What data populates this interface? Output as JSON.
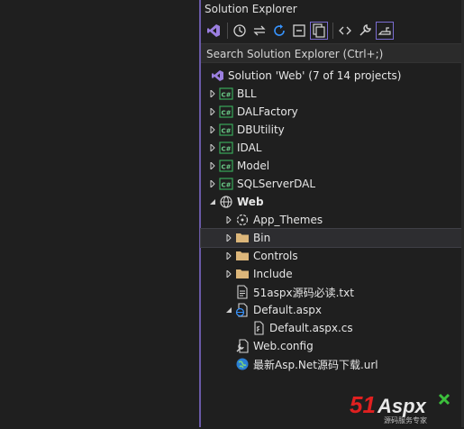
{
  "panel": {
    "title": "Solution Explorer",
    "search_placeholder": "Search Solution Explorer (Ctrl+;)"
  },
  "toolbar": [
    {
      "name": "vs-icon"
    },
    {
      "name": "history-icon"
    },
    {
      "name": "sync-icon"
    },
    {
      "name": "refresh-icon"
    },
    {
      "name": "collapse-all-icon"
    },
    {
      "name": "show-all-files-icon",
      "active": true
    },
    {
      "name": "code-icon"
    },
    {
      "name": "properties-icon"
    },
    {
      "name": "preview-icon",
      "active": true
    }
  ],
  "tree": {
    "solution": "Solution 'Web' (7 of 14 projects)",
    "items": [
      {
        "label": "BLL",
        "icon": "csharp-project-icon",
        "expandable": true
      },
      {
        "label": "DALFactory",
        "icon": "csharp-project-icon",
        "expandable": true
      },
      {
        "label": "DBUtility",
        "icon": "csharp-project-icon",
        "expandable": true
      },
      {
        "label": "IDAL",
        "icon": "csharp-project-icon",
        "expandable": true
      },
      {
        "label": "Model",
        "icon": "csharp-project-icon",
        "expandable": true
      },
      {
        "label": "SQLServerDAL",
        "icon": "csharp-project-icon",
        "expandable": true
      },
      {
        "label": "Web",
        "icon": "web-project-icon",
        "expanded": true
      },
      {
        "label": "App_Themes",
        "icon": "themes-icon",
        "expandable": true
      },
      {
        "label": "Bin",
        "icon": "folder-icon",
        "expandable": true,
        "selected": true
      },
      {
        "label": "Controls",
        "icon": "folder-icon",
        "expandable": true
      },
      {
        "label": "Include",
        "icon": "folder-icon",
        "expandable": true
      },
      {
        "label": "51aspx源码必读.txt",
        "icon": "text-file-icon"
      },
      {
        "label": "Default.aspx",
        "icon": "aspx-file-icon",
        "expanded": true
      },
      {
        "label": "Default.aspx.cs",
        "icon": "cs-file-icon"
      },
      {
        "label": "Web.config",
        "icon": "config-file-icon"
      },
      {
        "label": "最新Asp.Net源码下载.url",
        "icon": "url-file-icon"
      }
    ]
  },
  "logo": {
    "text": "51Aspx",
    "subtext": "源码服务专家"
  }
}
